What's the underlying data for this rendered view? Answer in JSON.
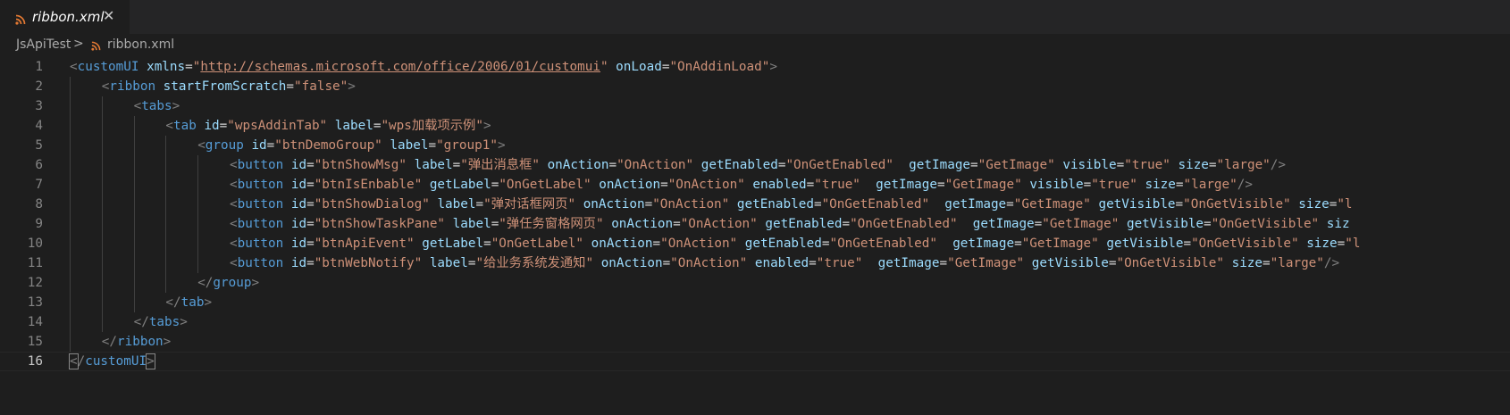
{
  "tab": {
    "label": "ribbon.xml",
    "close": "✕",
    "icon": "rss-icon",
    "icon_color": "#e37933"
  },
  "breadcrumb": {
    "root": "JsApiTest",
    "separator": ">",
    "file": "ribbon.xml"
  },
  "colors": {
    "tag": "#569cd6",
    "attr": "#9cdcfe",
    "string": "#ce9178",
    "bracket": "#808080",
    "background": "#1e1e1e"
  },
  "active_line": 16,
  "lines": [
    {
      "n": "1",
      "indent": 0,
      "tokens": [
        [
          "br",
          "<"
        ],
        [
          "tag",
          "customUI"
        ],
        [
          "txt",
          " "
        ],
        [
          "attr",
          "xmlns"
        ],
        [
          "eq",
          "="
        ],
        [
          "str",
          "\""
        ],
        [
          "url",
          "http://schemas.microsoft.com/office/2006/01/customui"
        ],
        [
          "str",
          "\""
        ],
        [
          "txt",
          " "
        ],
        [
          "attr",
          "onLoad"
        ],
        [
          "eq",
          "="
        ],
        [
          "str",
          "\"OnAddinLoad\""
        ],
        [
          "br",
          ">"
        ]
      ]
    },
    {
      "n": "2",
      "indent": 1,
      "tokens": [
        [
          "br",
          "<"
        ],
        [
          "tag",
          "ribbon"
        ],
        [
          "txt",
          " "
        ],
        [
          "attr",
          "startFromScratch"
        ],
        [
          "eq",
          "="
        ],
        [
          "str",
          "\"false\""
        ],
        [
          "br",
          ">"
        ]
      ]
    },
    {
      "n": "3",
      "indent": 2,
      "tokens": [
        [
          "br",
          "<"
        ],
        [
          "tag",
          "tabs"
        ],
        [
          "br",
          ">"
        ]
      ]
    },
    {
      "n": "4",
      "indent": 3,
      "tokens": [
        [
          "br",
          "<"
        ],
        [
          "tag",
          "tab"
        ],
        [
          "txt",
          " "
        ],
        [
          "attr",
          "id"
        ],
        [
          "eq",
          "="
        ],
        [
          "str",
          "\"wpsAddinTab\""
        ],
        [
          "txt",
          " "
        ],
        [
          "attr",
          "label"
        ],
        [
          "eq",
          "="
        ],
        [
          "str",
          "\"wps加载项示例\""
        ],
        [
          "br",
          ">"
        ]
      ]
    },
    {
      "n": "5",
      "indent": 4,
      "tokens": [
        [
          "br",
          "<"
        ],
        [
          "tag",
          "group"
        ],
        [
          "txt",
          " "
        ],
        [
          "attr",
          "id"
        ],
        [
          "eq",
          "="
        ],
        [
          "str",
          "\"btnDemoGroup\""
        ],
        [
          "txt",
          " "
        ],
        [
          "attr",
          "label"
        ],
        [
          "eq",
          "="
        ],
        [
          "str",
          "\"group1\""
        ],
        [
          "br",
          ">"
        ]
      ]
    },
    {
      "n": "6",
      "indent": 5,
      "tokens": [
        [
          "br",
          "<"
        ],
        [
          "tag",
          "button"
        ],
        [
          "txt",
          " "
        ],
        [
          "attr",
          "id"
        ],
        [
          "eq",
          "="
        ],
        [
          "str",
          "\"btnShowMsg\""
        ],
        [
          "txt",
          " "
        ],
        [
          "attr",
          "label"
        ],
        [
          "eq",
          "="
        ],
        [
          "str",
          "\"弹出消息框\""
        ],
        [
          "txt",
          " "
        ],
        [
          "attr",
          "onAction"
        ],
        [
          "eq",
          "="
        ],
        [
          "str",
          "\"OnAction\""
        ],
        [
          "txt",
          " "
        ],
        [
          "attr",
          "getEnabled"
        ],
        [
          "eq",
          "="
        ],
        [
          "str",
          "\"OnGetEnabled\""
        ],
        [
          "txt",
          "  "
        ],
        [
          "attr",
          "getImage"
        ],
        [
          "eq",
          "="
        ],
        [
          "str",
          "\"GetImage\""
        ],
        [
          "txt",
          " "
        ],
        [
          "attr",
          "visible"
        ],
        [
          "eq",
          "="
        ],
        [
          "str",
          "\"true\""
        ],
        [
          "txt",
          " "
        ],
        [
          "attr",
          "size"
        ],
        [
          "eq",
          "="
        ],
        [
          "str",
          "\"large\""
        ],
        [
          "br",
          "/>"
        ]
      ]
    },
    {
      "n": "7",
      "indent": 5,
      "tokens": [
        [
          "br",
          "<"
        ],
        [
          "tag",
          "button"
        ],
        [
          "txt",
          " "
        ],
        [
          "attr",
          "id"
        ],
        [
          "eq",
          "="
        ],
        [
          "str",
          "\"btnIsEnbable\""
        ],
        [
          "txt",
          " "
        ],
        [
          "attr",
          "getLabel"
        ],
        [
          "eq",
          "="
        ],
        [
          "str",
          "\"OnGetLabel\""
        ],
        [
          "txt",
          " "
        ],
        [
          "attr",
          "onAction"
        ],
        [
          "eq",
          "="
        ],
        [
          "str",
          "\"OnAction\""
        ],
        [
          "txt",
          " "
        ],
        [
          "attr",
          "enabled"
        ],
        [
          "eq",
          "="
        ],
        [
          "str",
          "\"true\""
        ],
        [
          "txt",
          "  "
        ],
        [
          "attr",
          "getImage"
        ],
        [
          "eq",
          "="
        ],
        [
          "str",
          "\"GetImage\""
        ],
        [
          "txt",
          " "
        ],
        [
          "attr",
          "visible"
        ],
        [
          "eq",
          "="
        ],
        [
          "str",
          "\"true\""
        ],
        [
          "txt",
          " "
        ],
        [
          "attr",
          "size"
        ],
        [
          "eq",
          "="
        ],
        [
          "str",
          "\"large\""
        ],
        [
          "br",
          "/>"
        ]
      ]
    },
    {
      "n": "8",
      "indent": 5,
      "tokens": [
        [
          "br",
          "<"
        ],
        [
          "tag",
          "button"
        ],
        [
          "txt",
          " "
        ],
        [
          "attr",
          "id"
        ],
        [
          "eq",
          "="
        ],
        [
          "str",
          "\"btnShowDialog\""
        ],
        [
          "txt",
          " "
        ],
        [
          "attr",
          "label"
        ],
        [
          "eq",
          "="
        ],
        [
          "str",
          "\"弹对话框网页\""
        ],
        [
          "txt",
          " "
        ],
        [
          "attr",
          "onAction"
        ],
        [
          "eq",
          "="
        ],
        [
          "str",
          "\"OnAction\""
        ],
        [
          "txt",
          " "
        ],
        [
          "attr",
          "getEnabled"
        ],
        [
          "eq",
          "="
        ],
        [
          "str",
          "\"OnGetEnabled\""
        ],
        [
          "txt",
          "  "
        ],
        [
          "attr",
          "getImage"
        ],
        [
          "eq",
          "="
        ],
        [
          "str",
          "\"GetImage\""
        ],
        [
          "txt",
          " "
        ],
        [
          "attr",
          "getVisible"
        ],
        [
          "eq",
          "="
        ],
        [
          "str",
          "\"OnGetVisible\""
        ],
        [
          "txt",
          " "
        ],
        [
          "attr",
          "size"
        ],
        [
          "eq",
          "="
        ],
        [
          "str",
          "\"l"
        ]
      ]
    },
    {
      "n": "9",
      "indent": 5,
      "tokens": [
        [
          "br",
          "<"
        ],
        [
          "tag",
          "button"
        ],
        [
          "txt",
          " "
        ],
        [
          "attr",
          "id"
        ],
        [
          "eq",
          "="
        ],
        [
          "str",
          "\"btnShowTaskPane\""
        ],
        [
          "txt",
          " "
        ],
        [
          "attr",
          "label"
        ],
        [
          "eq",
          "="
        ],
        [
          "str",
          "\"弹任务窗格网页\""
        ],
        [
          "txt",
          " "
        ],
        [
          "attr",
          "onAction"
        ],
        [
          "eq",
          "="
        ],
        [
          "str",
          "\"OnAction\""
        ],
        [
          "txt",
          " "
        ],
        [
          "attr",
          "getEnabled"
        ],
        [
          "eq",
          "="
        ],
        [
          "str",
          "\"OnGetEnabled\""
        ],
        [
          "txt",
          "  "
        ],
        [
          "attr",
          "getImage"
        ],
        [
          "eq",
          "="
        ],
        [
          "str",
          "\"GetImage\""
        ],
        [
          "txt",
          " "
        ],
        [
          "attr",
          "getVisible"
        ],
        [
          "eq",
          "="
        ],
        [
          "str",
          "\"OnGetVisible\""
        ],
        [
          "txt",
          " "
        ],
        [
          "attr",
          "siz"
        ]
      ]
    },
    {
      "n": "10",
      "indent": 5,
      "tokens": [
        [
          "br",
          "<"
        ],
        [
          "tag",
          "button"
        ],
        [
          "txt",
          " "
        ],
        [
          "attr",
          "id"
        ],
        [
          "eq",
          "="
        ],
        [
          "str",
          "\"btnApiEvent\""
        ],
        [
          "txt",
          " "
        ],
        [
          "attr",
          "getLabel"
        ],
        [
          "eq",
          "="
        ],
        [
          "str",
          "\"OnGetLabel\""
        ],
        [
          "txt",
          " "
        ],
        [
          "attr",
          "onAction"
        ],
        [
          "eq",
          "="
        ],
        [
          "str",
          "\"OnAction\""
        ],
        [
          "txt",
          " "
        ],
        [
          "attr",
          "getEnabled"
        ],
        [
          "eq",
          "="
        ],
        [
          "str",
          "\"OnGetEnabled\""
        ],
        [
          "txt",
          "  "
        ],
        [
          "attr",
          "getImage"
        ],
        [
          "eq",
          "="
        ],
        [
          "str",
          "\"GetImage\""
        ],
        [
          "txt",
          " "
        ],
        [
          "attr",
          "getVisible"
        ],
        [
          "eq",
          "="
        ],
        [
          "str",
          "\"OnGetVisible\""
        ],
        [
          "txt",
          " "
        ],
        [
          "attr",
          "size"
        ],
        [
          "eq",
          "="
        ],
        [
          "str",
          "\"l"
        ]
      ]
    },
    {
      "n": "11",
      "indent": 5,
      "tokens": [
        [
          "br",
          "<"
        ],
        [
          "tag",
          "button"
        ],
        [
          "txt",
          " "
        ],
        [
          "attr",
          "id"
        ],
        [
          "eq",
          "="
        ],
        [
          "str",
          "\"btnWebNotify\""
        ],
        [
          "txt",
          " "
        ],
        [
          "attr",
          "label"
        ],
        [
          "eq",
          "="
        ],
        [
          "str",
          "\"给业务系统发通知\""
        ],
        [
          "txt",
          " "
        ],
        [
          "attr",
          "onAction"
        ],
        [
          "eq",
          "="
        ],
        [
          "str",
          "\"OnAction\""
        ],
        [
          "txt",
          " "
        ],
        [
          "attr",
          "enabled"
        ],
        [
          "eq",
          "="
        ],
        [
          "str",
          "\"true\""
        ],
        [
          "txt",
          "  "
        ],
        [
          "attr",
          "getImage"
        ],
        [
          "eq",
          "="
        ],
        [
          "str",
          "\"GetImage\""
        ],
        [
          "txt",
          " "
        ],
        [
          "attr",
          "getVisible"
        ],
        [
          "eq",
          "="
        ],
        [
          "str",
          "\"OnGetVisible\""
        ],
        [
          "txt",
          " "
        ],
        [
          "attr",
          "size"
        ],
        [
          "eq",
          "="
        ],
        [
          "str",
          "\"large\""
        ],
        [
          "br",
          "/>"
        ]
      ]
    },
    {
      "n": "12",
      "indent": 4,
      "tokens": [
        [
          "br",
          "</"
        ],
        [
          "tag",
          "group"
        ],
        [
          "br",
          ">"
        ]
      ]
    },
    {
      "n": "13",
      "indent": 3,
      "tokens": [
        [
          "br",
          "</"
        ],
        [
          "tag",
          "tab"
        ],
        [
          "br",
          ">"
        ]
      ]
    },
    {
      "n": "14",
      "indent": 2,
      "tokens": [
        [
          "br",
          "</"
        ],
        [
          "tag",
          "tabs"
        ],
        [
          "br",
          ">"
        ]
      ]
    },
    {
      "n": "15",
      "indent": 1,
      "tokens": [
        [
          "br",
          "</"
        ],
        [
          "tag",
          "ribbon"
        ],
        [
          "br",
          ">"
        ]
      ]
    },
    {
      "n": "16",
      "indent": 0,
      "tokens": [
        [
          "brm",
          "<"
        ],
        [
          "br",
          "/"
        ],
        [
          "tag",
          "customUI"
        ],
        [
          "brm",
          ">"
        ]
      ]
    }
  ]
}
